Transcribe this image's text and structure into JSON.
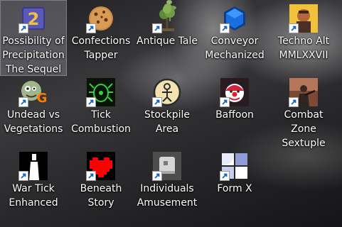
{
  "desktop": {
    "icons": [
      {
        "label": "Possibility of\nPrecipitation\nThe Sequel",
        "icon": "purple-2-logo-icon",
        "selected": true
      },
      {
        "label": "Confections\nTapper",
        "icon": "cookie-icon",
        "selected": false
      },
      {
        "label": "Antique Tale",
        "icon": "tree-icon",
        "selected": false
      },
      {
        "label": "Conveyor\nMechanized",
        "icon": "blue-hexagon-icon",
        "selected": false
      },
      {
        "label": "Techno Alt\nMMLXXVII",
        "icon": "portrait-icon",
        "selected": false
      },
      {
        "label": "Undead vs\nVegetations",
        "icon": "zombie-head-icon",
        "selected": false
      },
      {
        "label": "Tick\nCombustion",
        "icon": "green-tick-icon",
        "selected": false
      },
      {
        "label": "Stockpile\nArea",
        "icon": "figure-circle-icon",
        "selected": false
      },
      {
        "label": "Baffoon",
        "icon": "clown-icon",
        "selected": false
      },
      {
        "label": "Combat Zone\nSextuple",
        "icon": "soldier-icon",
        "selected": false
      },
      {
        "label": "War Tick\nEnhanced",
        "icon": "white-figure-icon",
        "selected": false
      },
      {
        "label": "Beneath\nStory",
        "icon": "red-heart-icon",
        "selected": false
      },
      {
        "label": "Individuals\nAmusement",
        "icon": "gray-cube-icon",
        "selected": false
      },
      {
        "label": "Form X",
        "icon": "blue-square-grid-icon",
        "selected": false
      }
    ]
  }
}
